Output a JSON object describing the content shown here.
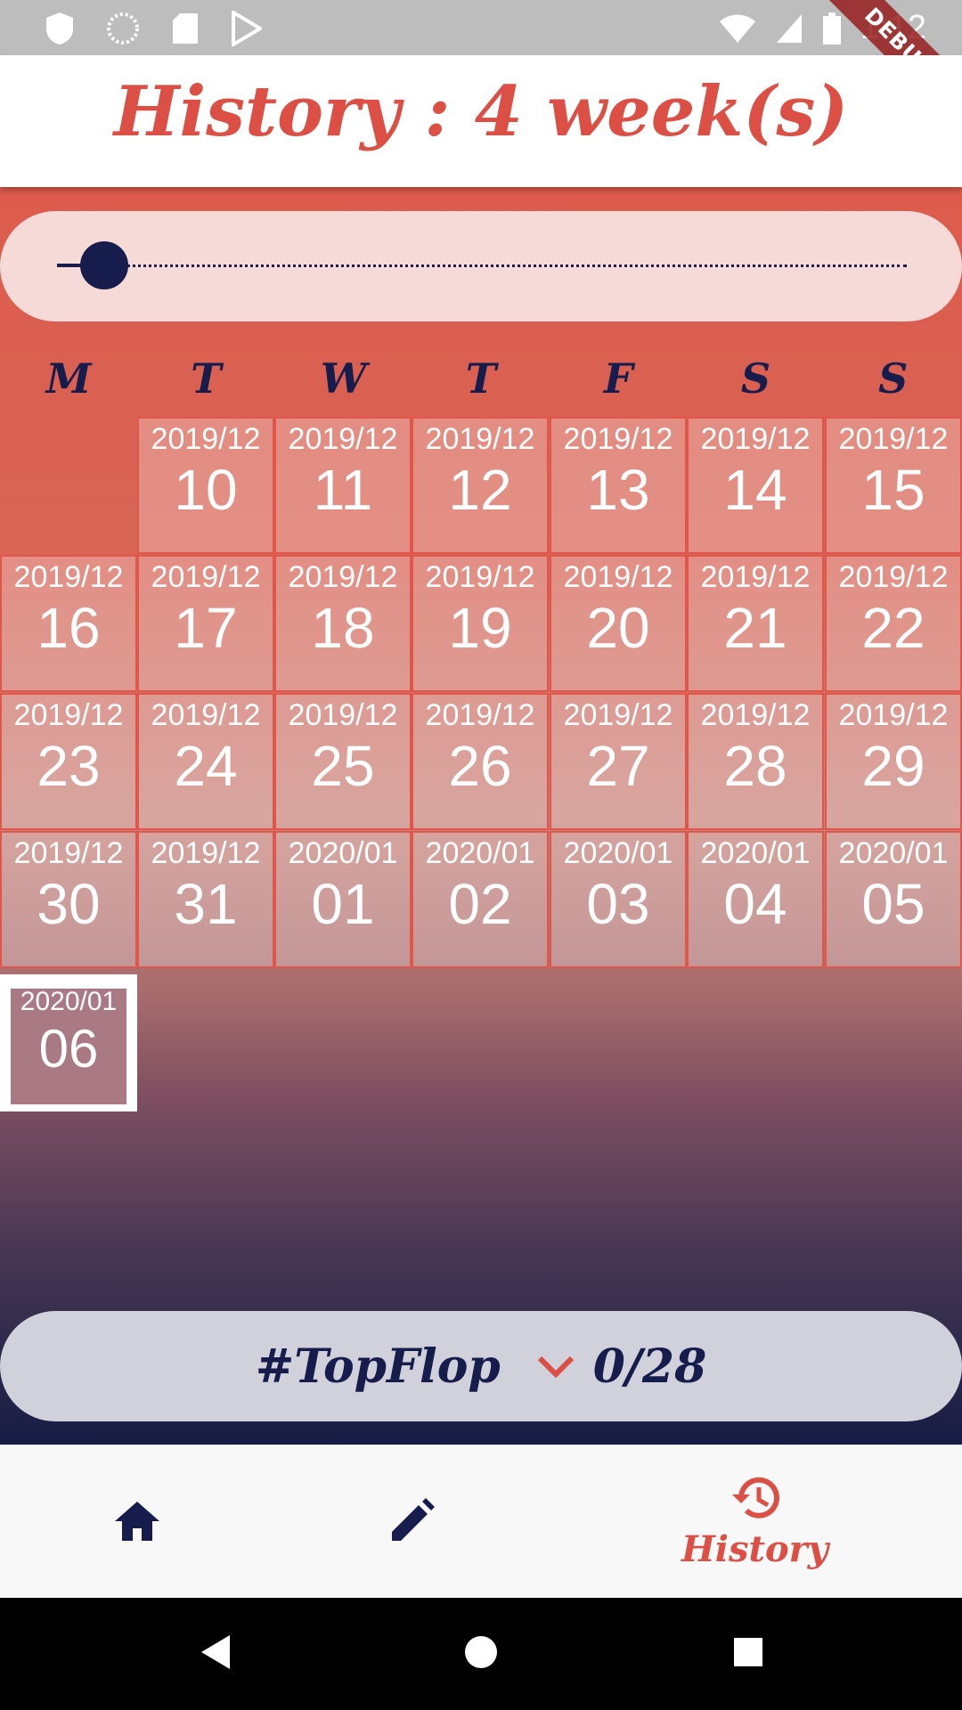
{
  "status_bar": {
    "time": "1:12",
    "debug_label": "DEBUG"
  },
  "header": {
    "title": "History :  4 week(s)"
  },
  "slider": {
    "value_weeks": 4
  },
  "weekdays": [
    "M",
    "T",
    "W",
    "T",
    "F",
    "S",
    "S"
  ],
  "calendar": {
    "cells": [
      {
        "ym": "2019/12",
        "day": "10"
      },
      {
        "ym": "2019/12",
        "day": "11"
      },
      {
        "ym": "2019/12",
        "day": "12"
      },
      {
        "ym": "2019/12",
        "day": "13"
      },
      {
        "ym": "2019/12",
        "day": "14"
      },
      {
        "ym": "2019/12",
        "day": "15"
      },
      {
        "ym": "2019/12",
        "day": "16"
      },
      {
        "ym": "2019/12",
        "day": "17"
      },
      {
        "ym": "2019/12",
        "day": "18"
      },
      {
        "ym": "2019/12",
        "day": "19"
      },
      {
        "ym": "2019/12",
        "day": "20"
      },
      {
        "ym": "2019/12",
        "day": "21"
      },
      {
        "ym": "2019/12",
        "day": "22"
      },
      {
        "ym": "2019/12",
        "day": "23"
      },
      {
        "ym": "2019/12",
        "day": "24"
      },
      {
        "ym": "2019/12",
        "day": "25"
      },
      {
        "ym": "2019/12",
        "day": "26"
      },
      {
        "ym": "2019/12",
        "day": "27"
      },
      {
        "ym": "2019/12",
        "day": "28"
      },
      {
        "ym": "2019/12",
        "day": "29"
      },
      {
        "ym": "2019/12",
        "day": "30"
      },
      {
        "ym": "2019/12",
        "day": "31"
      },
      {
        "ym": "2020/01",
        "day": "01"
      },
      {
        "ym": "2020/01",
        "day": "02"
      },
      {
        "ym": "2020/01",
        "day": "03"
      },
      {
        "ym": "2020/01",
        "day": "04"
      },
      {
        "ym": "2020/01",
        "day": "05"
      }
    ],
    "selected": {
      "ym": "2020/01",
      "day": "06"
    }
  },
  "summary": {
    "tag": "#TopFlop",
    "count": "0/28"
  },
  "bottom_nav": {
    "history_label": "History"
  },
  "colors": {
    "accent": "#db4f45",
    "navy": "#161c4c"
  }
}
